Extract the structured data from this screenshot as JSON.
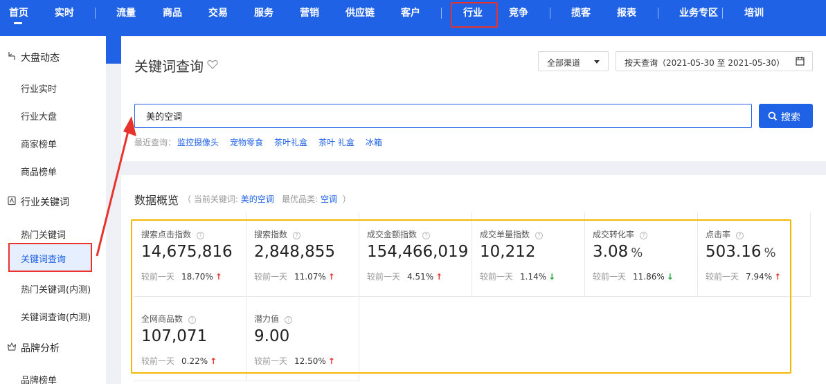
{
  "nav": {
    "items": [
      "首页",
      "实时",
      "流量",
      "商品",
      "交易",
      "服务",
      "营销",
      "供应链",
      "客户",
      "行业",
      "竞争",
      "揽客",
      "报表",
      "业务专区",
      "培训"
    ],
    "active": "首页",
    "highlighted": "行业"
  },
  "sidebar": {
    "groups": [
      {
        "label": "大盘动态",
        "items": [
          "行业实时",
          "行业大盘",
          "商家榜单",
          "商品榜单"
        ]
      },
      {
        "label": "行业关键词",
        "items": [
          "热门关键词",
          "关键词查询",
          "热门关键词(内测)",
          "关键词查询(内测)"
        ]
      },
      {
        "label": "品牌分析",
        "items": [
          "品牌榜单"
        ]
      }
    ],
    "active_item": "关键词查询"
  },
  "header": {
    "title": "关键词查询",
    "channel_select": "全部渠道",
    "date_range": "按天查询（2021-05-30 至 2021-05-30）"
  },
  "search": {
    "value": "美的空调",
    "button_label": "搜索",
    "recent_label": "最近查询：",
    "recent_items": [
      "监控摄像头",
      "宠物零食",
      "茶叶礼盒",
      "茶叶 礼盒",
      "冰箱"
    ]
  },
  "overview": {
    "title": "数据概览",
    "sub_prefix": "（ 当前关键词:",
    "current_keyword": "美的空调",
    "sub_mid": "最优品类:",
    "best_category": "空调",
    "sub_suffix": "）",
    "compare_label": "较前一天",
    "metrics": [
      {
        "label": "搜索点击指数",
        "value": "14,675,816",
        "unit": "",
        "change": "18.70%",
        "trend": "up"
      },
      {
        "label": "搜索指数",
        "value": "2,848,855",
        "unit": "",
        "change": "11.07%",
        "trend": "up"
      },
      {
        "label": "成交金额指数",
        "value": "154,466,019",
        "unit": "",
        "change": "4.51%",
        "trend": "up"
      },
      {
        "label": "成交单量指数",
        "value": "10,212",
        "unit": "",
        "change": "1.14%",
        "trend": "down"
      },
      {
        "label": "成交转化率",
        "value": "3.08",
        "unit": "%",
        "change": "11.86%",
        "trend": "down"
      },
      {
        "label": "点击率",
        "value": "503.16",
        "unit": "%",
        "change": "7.94%",
        "trend": "up"
      },
      {
        "label": "全网商品数",
        "value": "107,071",
        "unit": "",
        "change": "0.22%",
        "trend": "up"
      },
      {
        "label": "潜力值",
        "value": "9.00",
        "unit": "",
        "change": "12.50%",
        "trend": "up"
      }
    ]
  },
  "colors": {
    "brand": "#2062e6",
    "up": "#e8332d",
    "down": "#21a637",
    "highlight_box": "#f5b800",
    "annotation": "#e8332d"
  }
}
